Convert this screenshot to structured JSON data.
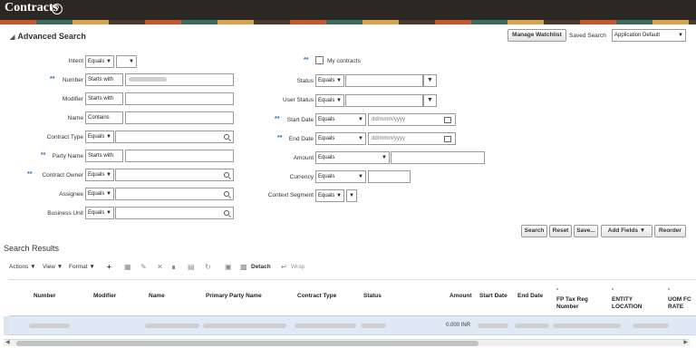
{
  "header": {
    "title": "Contracts",
    "help": "?"
  },
  "search": {
    "title": "Advanced Search",
    "manage_watchlist": "Manage Watchlist",
    "saved_search_label": "Saved Search",
    "saved_search_value": "Application Default",
    "required_marker": "**",
    "left_fields": [
      {
        "label": "Intent",
        "operator": "Equals",
        "value": ""
      },
      {
        "label": "Number",
        "operator": "Starts with",
        "value": "",
        "required": true
      },
      {
        "label": "Modifier",
        "operator": "Starts with",
        "value": ""
      },
      {
        "label": "Name",
        "operator": "Contains",
        "value": ""
      },
      {
        "label": "Contract Type",
        "operator": "Equals",
        "value": ""
      },
      {
        "label": "Party Name",
        "operator": "Starts with",
        "value": "",
        "required": true
      },
      {
        "label": "Contract Owner",
        "operator": "Equals",
        "value": "",
        "required": true
      },
      {
        "label": "Assignee",
        "operator": "Equals",
        "value": ""
      },
      {
        "label": "Business Unit",
        "operator": "Equals",
        "value": ""
      }
    ],
    "right_fields": {
      "my_contracts": "My contracts",
      "status": {
        "label": "Status",
        "operator": "Equals"
      },
      "user_status": {
        "label": "User Status",
        "operator": "Equals"
      },
      "start_date": {
        "label": "Start Date",
        "operator": "Equals",
        "placeholder": "dd/mmm/yyyy"
      },
      "end_date": {
        "label": "End Date",
        "operator": "Equals",
        "placeholder": "dd/mmm/yyyy"
      },
      "amount": {
        "label": "Amount",
        "operator": "Equals"
      },
      "currency": {
        "label": "Currency",
        "operator": "Equals"
      },
      "context_segment": {
        "label": "Context Segment",
        "operator": "Equals"
      }
    },
    "buttons": {
      "search": "Search",
      "reset": "Reset",
      "save": "Save...",
      "add_fields": "Add Fields",
      "reorder": "Reorder"
    }
  },
  "results": {
    "title": "Search Results",
    "toolbar": {
      "actions": "Actions",
      "view": "View",
      "format": "Format",
      "detach": "Detach",
      "wrap": "Wrap"
    },
    "columns": [
      "Number",
      "Modifier",
      "Name",
      "Primary Party Name",
      "Contract Type",
      "Status",
      "Amount",
      "Start Date",
      "End Date",
      "FP Tax Reg Number",
      "ENTITY LOCATION",
      "UOM FC RATE"
    ],
    "rows": [
      {
        "amount": "0.000",
        "currency": "INR"
      }
    ]
  }
}
